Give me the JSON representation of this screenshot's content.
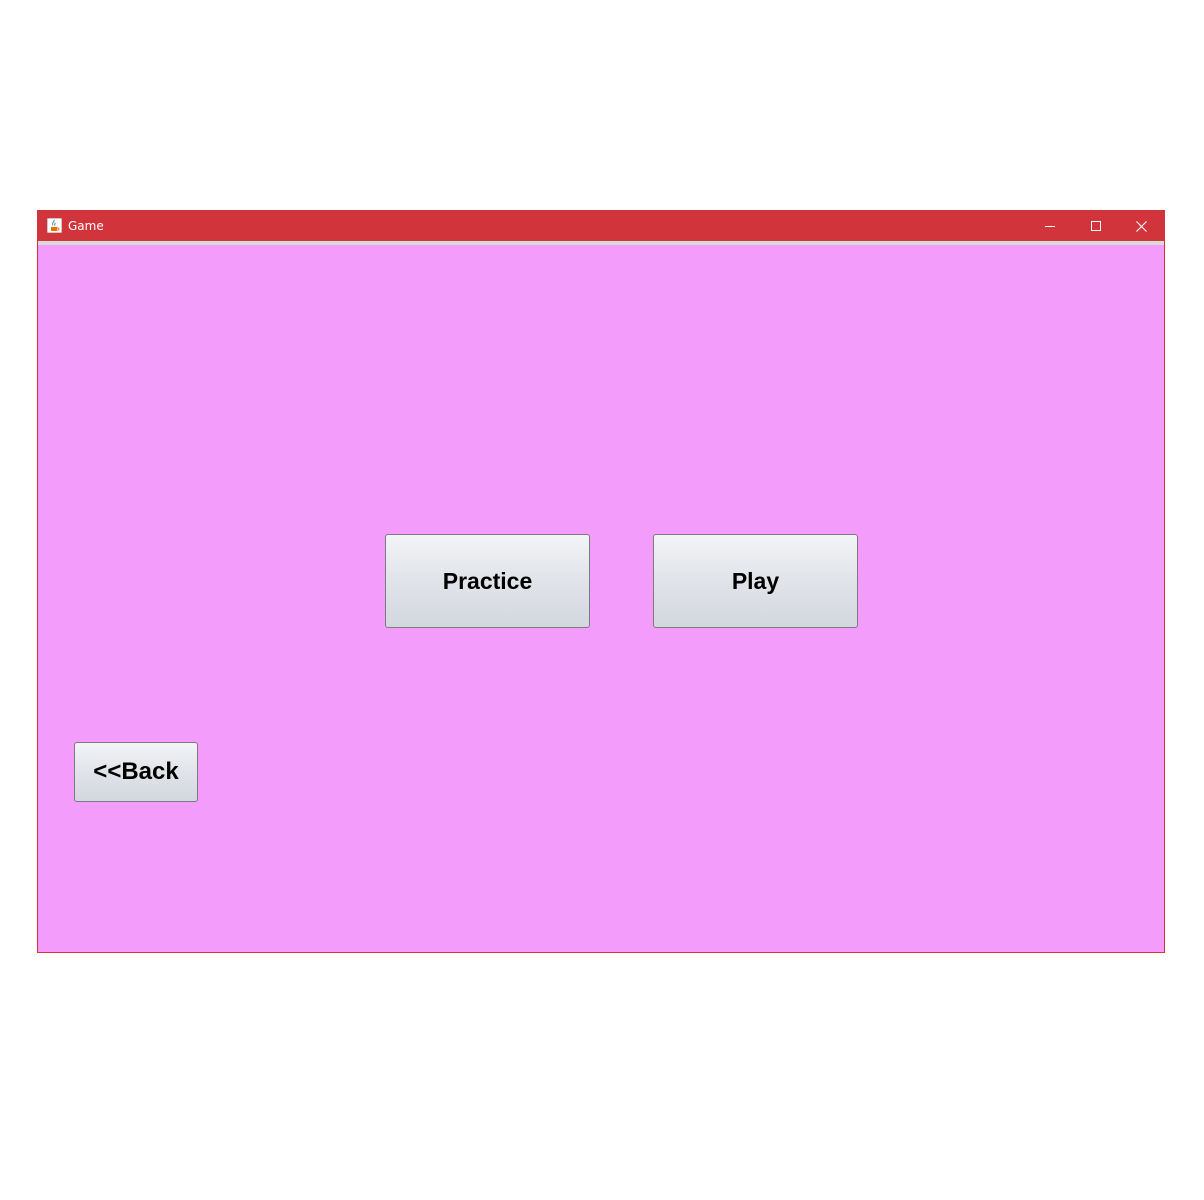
{
  "window": {
    "title": "Game",
    "app_icon": "java-cup-icon",
    "controls": {
      "minimize_icon": "minimize-icon",
      "maximize_icon": "maximize-icon",
      "close_icon": "close-icon"
    }
  },
  "main": {
    "practice_label": "Practice",
    "play_label": "Play",
    "back_label": "<<Back"
  },
  "colors": {
    "titlebar": "#d1343a",
    "background": "#f49cfc",
    "button_face": "#e2e5ea",
    "button_text": "#000000"
  }
}
